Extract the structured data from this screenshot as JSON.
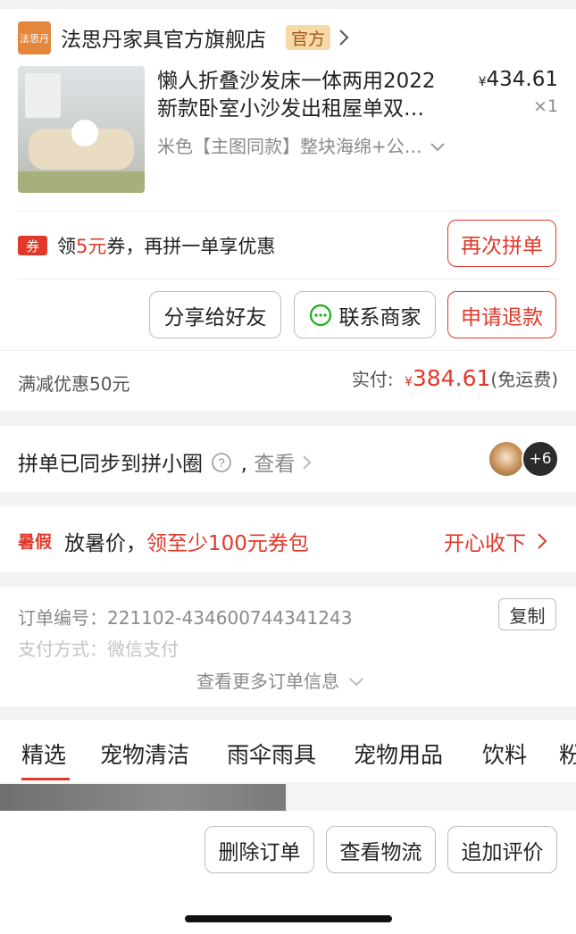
{
  "store": {
    "logo_text": "法思丹",
    "name": "法思丹家具官方旗舰店",
    "badge": "官方"
  },
  "product": {
    "title_line1": "懒人折叠沙发床一体两用2022",
    "title_line2": "新款卧室小沙发出租屋单双…",
    "price_symbol": "¥",
    "price": "434.61",
    "qty": "×1",
    "variant": "米色【主图同款】整块海绵+公…"
  },
  "coupon_row": {
    "tag": "券",
    "text_prefix": "领",
    "amount": "5元",
    "text_suffix": "券，再拼一单享优惠",
    "button": "再次拼单"
  },
  "actions": {
    "share": "分享给好友",
    "contact": "联系商家",
    "refund": "申请退款"
  },
  "payment": {
    "discount": "满减优惠50元",
    "paid_label": "实付:",
    "paid_symbol": "¥",
    "paid_amount": "384.61",
    "shipping": "(免运费)"
  },
  "circle": {
    "text": "拼单已同步到拼小圈",
    "view": "查看",
    "more_count": "+6"
  },
  "promo": {
    "tag": "暑假",
    "text": "放暑价，",
    "highlight": "领至少100元券包",
    "action": "开心收下"
  },
  "order_info": {
    "order_no_label": "订单编号：",
    "order_no": "221102-434600744341243",
    "copy": "复制",
    "pay_method_label": "支付方式：",
    "pay_method": "微信支付",
    "more": "查看更多订单信息"
  },
  "tabs": [
    "精选",
    "宠物清洁",
    "雨伞雨具",
    "宠物用品",
    "饮料",
    "粉"
  ],
  "bottom_actions": {
    "delete": "删除订单",
    "logistics": "查看物流",
    "review": "追加评价"
  },
  "colors": {
    "accent": "#e0392b",
    "badge_bg": "#f6d9a6",
    "badge_text": "#a0581d",
    "logo_bg": "#e4873c"
  }
}
